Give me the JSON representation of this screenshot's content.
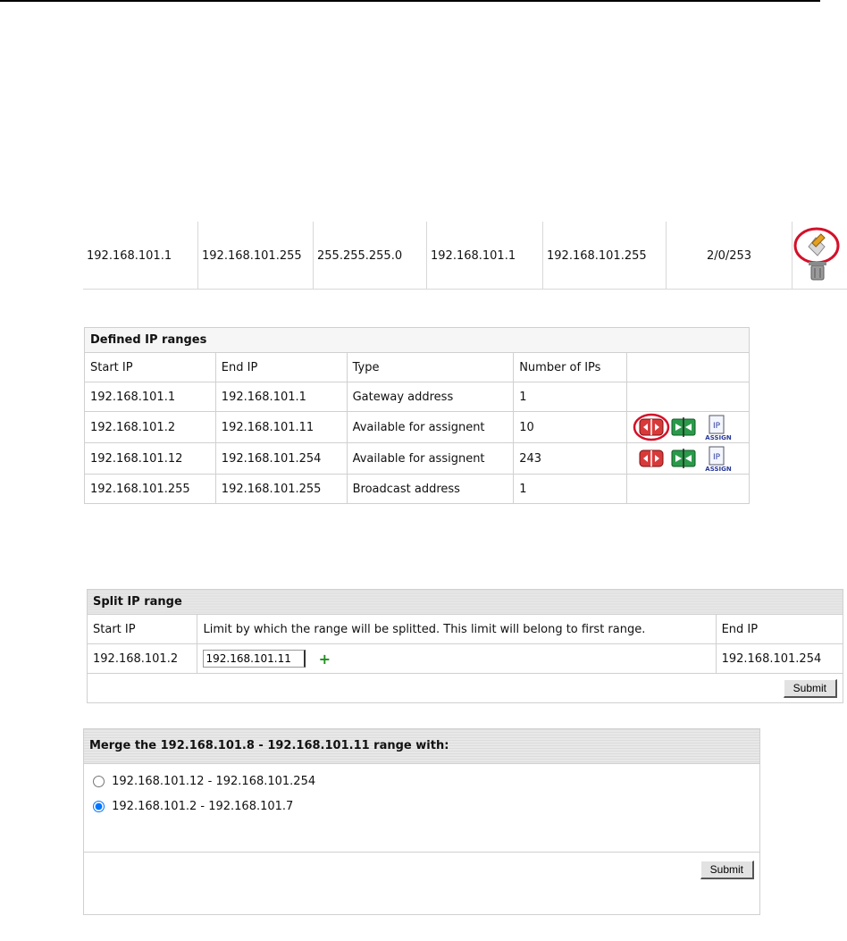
{
  "subnet": {
    "cells": [
      "192.168.101.1",
      "192.168.101.255",
      "255.255.255.0",
      "192.168.101.1",
      "192.168.101.255",
      "2/0/253"
    ],
    "actions": [
      "edit-icon",
      "delete-icon"
    ]
  },
  "ranges": {
    "caption": "Defined IP ranges",
    "headers": [
      "Start IP",
      "End IP",
      "Type",
      "Number of IPs"
    ],
    "rows": [
      {
        "start": "192.168.101.1",
        "end": "192.168.101.1",
        "type": "Gateway address",
        "count": "1",
        "actions": false
      },
      {
        "start": "192.168.101.2",
        "end": "192.168.101.11",
        "type": "Available for assignent",
        "count": "10",
        "actions": true
      },
      {
        "start": "192.168.101.12",
        "end": "192.168.101.254",
        "type": "Available for assignent",
        "count": "243",
        "actions": true
      },
      {
        "start": "192.168.101.255",
        "end": "192.168.101.255",
        "type": "Broadcast address",
        "count": "1",
        "actions": false
      }
    ],
    "assign_label_top": "IP",
    "assign_label_bottom": "ASSIGN"
  },
  "split": {
    "caption": "Split IP range",
    "headers": [
      "Start IP",
      "Limit by which the range will be splitted. This limit will belong to first range.",
      "End IP"
    ],
    "start_ip": "192.168.101.2",
    "limit_value": "192.168.101.11",
    "plus": "+",
    "end_ip": "192.168.101.254",
    "submit_label": "Submit"
  },
  "merge": {
    "caption": "Merge the 192.168.101.8 - 192.168.101.11 range with:",
    "options": [
      {
        "label": "192.168.101.12 - 192.168.101.254",
        "selected": false
      },
      {
        "label": "192.168.101.2 - 192.168.101.7",
        "selected": true
      }
    ],
    "submit_label": "Submit"
  },
  "colors": {
    "highlight_circle": "#d4102a",
    "split_red": "#d83a3a",
    "merge_green": "#2a9a4a"
  }
}
